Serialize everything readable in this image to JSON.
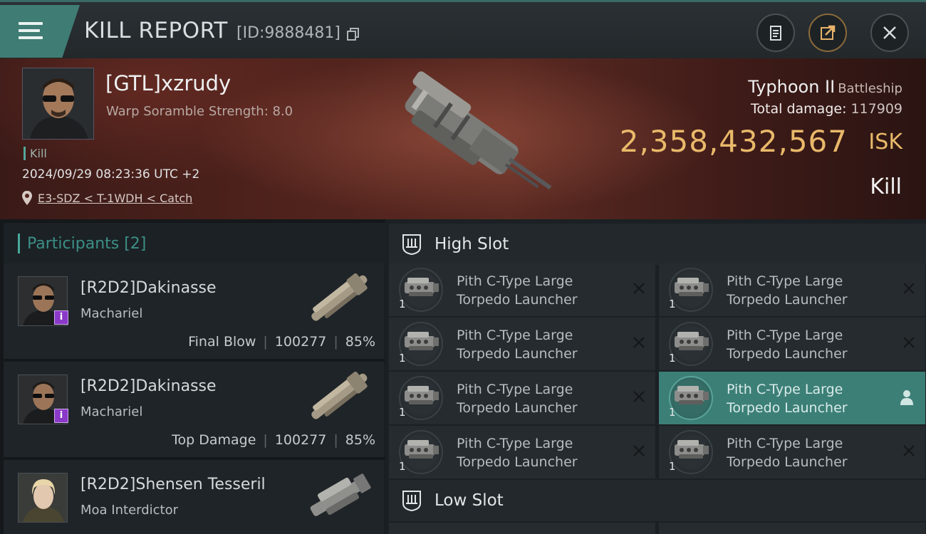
{
  "header": {
    "title": "KILL REPORT",
    "report_id": "[ID:9888481]",
    "buttons": {
      "clipboard": "clipboard-icon",
      "share": "share-icon",
      "close": "close-icon"
    }
  },
  "victim": {
    "name": "[GTL]xzrudy",
    "scramble": "Warp Soramble Strength: 8.0",
    "kill_tag": "Kill",
    "timestamp": "2024/09/29 08:23:36 UTC +2",
    "location": "E3-SDZ < T-1WDH < Catch",
    "ship_name": "Typhoon II",
    "ship_class": "Battleship",
    "total_damage_label": "Total damage:",
    "total_damage_value": "117909",
    "isk_value": "2,358,432,567",
    "isk_unit": "ISK",
    "result": "Kill"
  },
  "participants": {
    "header": "Participants [2]",
    "rows": [
      {
        "name": "[R2D2]Dakinasse",
        "ship": "Machariel",
        "role": "Final Blow",
        "damage": "100277",
        "percent": "85%",
        "badge": "i"
      },
      {
        "name": "[R2D2]Dakinasse",
        "ship": "Machariel",
        "role": "Top Damage",
        "damage": "100277",
        "percent": "85%",
        "badge": "i"
      },
      {
        "name": "[R2D2]Shensen Tesseril",
        "ship": "Moa Interdictor",
        "role": "",
        "damage": "",
        "percent": ""
      }
    ]
  },
  "fitting": {
    "high_slot_label": "High Slot",
    "low_slot_label": "Low Slot",
    "modules": [
      {
        "line1": "Pith C-Type Large",
        "line2": "Torpedo Launcher",
        "qty": "1"
      },
      {
        "line1": "Pith C-Type Large",
        "line2": "Torpedo Launcher",
        "qty": "1"
      },
      {
        "line1": "Pith C-Type Large",
        "line2": "Torpedo Launcher",
        "qty": "1"
      },
      {
        "line1": "Pith C-Type Large",
        "line2": "Torpedo Launcher",
        "qty": "1"
      },
      {
        "line1": "Pith C-Type Large",
        "line2": "Torpedo Launcher",
        "qty": "1"
      },
      {
        "line1": "Pith C-Type Large",
        "line2": "Torpedo Launcher",
        "qty": "1"
      },
      {
        "line1": "Pith C-Type Large",
        "line2": "Torpedo Launcher",
        "qty": "1"
      },
      {
        "line1": "Pith C-Type Large",
        "line2": "Torpedo Launcher",
        "qty": "1"
      }
    ]
  },
  "colors": {
    "accent": "#3f7c74",
    "isk": "#e9b96a",
    "badge": "#8a39c9"
  }
}
